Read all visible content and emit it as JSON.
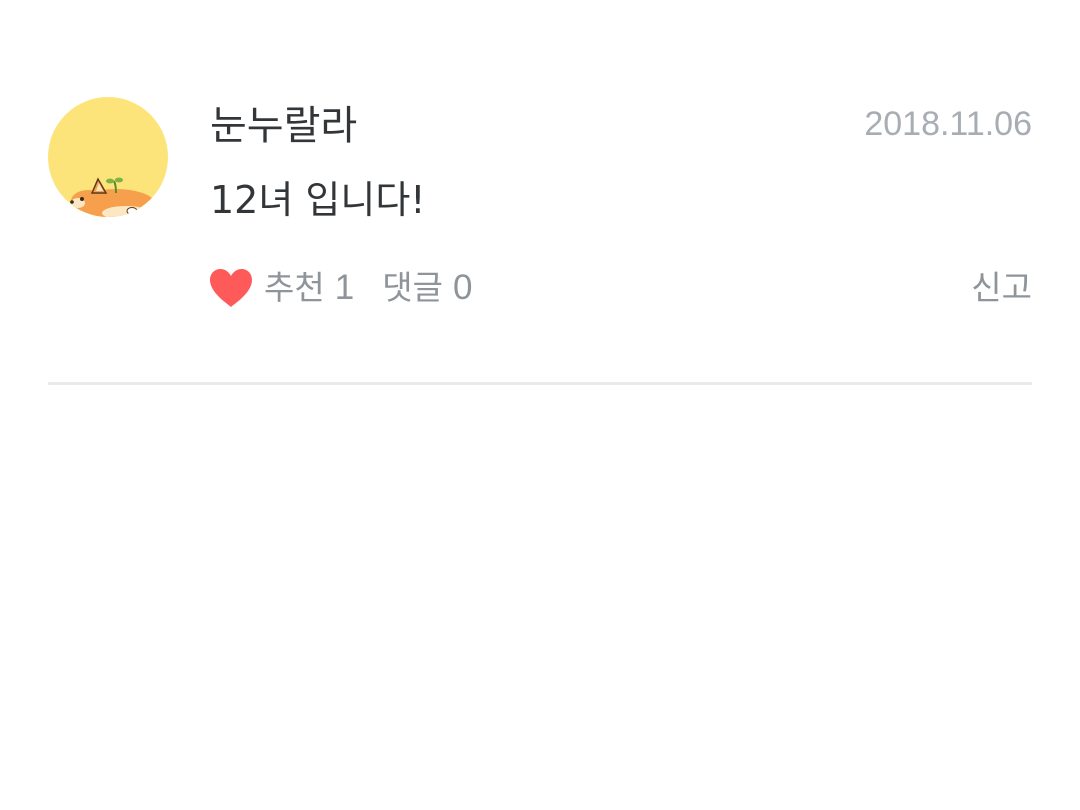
{
  "comment": {
    "avatar_icon": "corgi-avatar-icon",
    "avatar_color": "#fde47a",
    "username": "눈누랄라",
    "date": "2018.11.06",
    "text": "12녀 입니다!",
    "like": {
      "icon": "heart-icon",
      "icon_color": "#ff5a5a",
      "label": "추천",
      "count": "1"
    },
    "reply": {
      "label": "댓글",
      "count": "0"
    },
    "report_label": "신고"
  }
}
